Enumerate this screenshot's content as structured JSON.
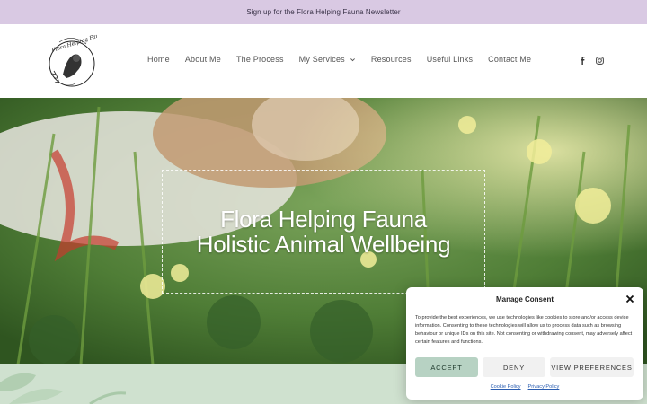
{
  "topbar": {
    "newsletter_link": "Sign up for the Flora Helping Fauna Newsletter"
  },
  "logo": {
    "text": "Flora Helping Fauna",
    "icon": "logo-icon"
  },
  "nav": {
    "items": [
      {
        "label": "Home"
      },
      {
        "label": "About Me"
      },
      {
        "label": "The Process"
      },
      {
        "label": "My Services",
        "has_dropdown": true
      },
      {
        "label": "Resources"
      },
      {
        "label": "Useful Links"
      },
      {
        "label": "Contact Me"
      }
    ]
  },
  "social": {
    "icons": [
      "facebook-icon",
      "instagram-icon"
    ]
  },
  "hero": {
    "title": "Flora Helping Fauna",
    "subtitle": "Holistic Animal Wellbeing"
  },
  "consent": {
    "title": "Manage Consent",
    "body": "To provide the best experiences, we use technologies like cookies to store and/or access device information. Consenting to these technologies will allow us to process data such as browsing behaviour or unique IDs on this site. Not consenting or withdrawing consent, may adversely affect certain features and functions.",
    "accept_label": "ACCEPT",
    "deny_label": "DENY",
    "preferences_label": "VIEW PREFERENCES",
    "cookie_policy_label": "Cookie Policy",
    "privacy_policy_label": "Privacy Policy"
  },
  "colors": {
    "topbar_bg": "#d9c9e3",
    "accept_bg": "#b7d2c3",
    "bottom_strip_bg": "#cfe1cf",
    "link": "#2a5db0"
  }
}
